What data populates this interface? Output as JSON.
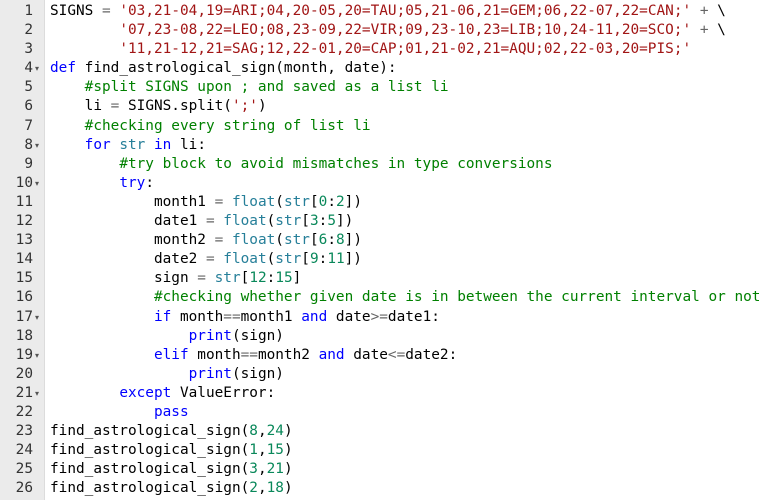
{
  "editor": {
    "lines": [
      {
        "n": "1",
        "fold": "",
        "segs": [
          {
            "t": "SIGNS",
            "k": "plain"
          },
          {
            "t": " ",
            "k": "plain"
          },
          {
            "t": "=",
            "k": "op"
          },
          {
            "t": " ",
            "k": "plain"
          },
          {
            "t": "'03,21-04,19=ARI;04,20-05,20=TAU;05,21-06,21=GEM;06,22-07,22=CAN;'",
            "k": "str"
          },
          {
            "t": " ",
            "k": "plain"
          },
          {
            "t": "+",
            "k": "op"
          },
          {
            "t": " \\",
            "k": "plain"
          }
        ]
      },
      {
        "n": "2",
        "fold": "",
        "segs": [
          {
            "t": "        ",
            "k": "plain"
          },
          {
            "t": "'07,23-08,22=LEO;08,23-09,22=VIR;09,23-10,23=LIB;10,24-11,20=SCO;'",
            "k": "str"
          },
          {
            "t": " ",
            "k": "plain"
          },
          {
            "t": "+",
            "k": "op"
          },
          {
            "t": " \\",
            "k": "plain"
          }
        ]
      },
      {
        "n": "3",
        "fold": "",
        "segs": [
          {
            "t": "        ",
            "k": "plain"
          },
          {
            "t": "'11,21-12,21=SAG;12,22-01,20=CAP;01,21-02,21=AQU;02,22-03,20=PIS;'",
            "k": "str"
          }
        ]
      },
      {
        "n": "4",
        "fold": "▾",
        "segs": [
          {
            "t": "def",
            "k": "kw"
          },
          {
            "t": " find_astrological_sign(month, date):",
            "k": "plain"
          }
        ]
      },
      {
        "n": "5",
        "fold": "",
        "segs": [
          {
            "t": "    ",
            "k": "plain"
          },
          {
            "t": "#split SIGNS upon ; and saved as a list li",
            "k": "cm"
          }
        ]
      },
      {
        "n": "6",
        "fold": "",
        "segs": [
          {
            "t": "    li ",
            "k": "plain"
          },
          {
            "t": "=",
            "k": "op"
          },
          {
            "t": " SIGNS.split(",
            "k": "plain"
          },
          {
            "t": "';'",
            "k": "str"
          },
          {
            "t": ")",
            "k": "plain"
          }
        ]
      },
      {
        "n": "7",
        "fold": "",
        "segs": [
          {
            "t": "    ",
            "k": "plain"
          },
          {
            "t": "#checking every string of list li",
            "k": "cm"
          }
        ]
      },
      {
        "n": "8",
        "fold": "▾",
        "segs": [
          {
            "t": "    ",
            "k": "plain"
          },
          {
            "t": "for",
            "k": "kw"
          },
          {
            "t": " ",
            "k": "plain"
          },
          {
            "t": "str",
            "k": "bi"
          },
          {
            "t": " ",
            "k": "plain"
          },
          {
            "t": "in",
            "k": "kw"
          },
          {
            "t": " li:",
            "k": "plain"
          }
        ]
      },
      {
        "n": "9",
        "fold": "",
        "segs": [
          {
            "t": "        ",
            "k": "plain"
          },
          {
            "t": "#try block to avoid mismatches in type conversions",
            "k": "cm"
          }
        ]
      },
      {
        "n": "10",
        "fold": "▾",
        "segs": [
          {
            "t": "        ",
            "k": "plain"
          },
          {
            "t": "try",
            "k": "kw"
          },
          {
            "t": ":",
            "k": "plain"
          }
        ]
      },
      {
        "n": "11",
        "fold": "",
        "segs": [
          {
            "t": "            month1 ",
            "k": "plain"
          },
          {
            "t": "=",
            "k": "op"
          },
          {
            "t": " ",
            "k": "plain"
          },
          {
            "t": "float",
            "k": "bi"
          },
          {
            "t": "(",
            "k": "plain"
          },
          {
            "t": "str",
            "k": "bi"
          },
          {
            "t": "[",
            "k": "plain"
          },
          {
            "t": "0",
            "k": "num"
          },
          {
            "t": ":",
            "k": "plain"
          },
          {
            "t": "2",
            "k": "num"
          },
          {
            "t": "])",
            "k": "plain"
          }
        ]
      },
      {
        "n": "12",
        "fold": "",
        "segs": [
          {
            "t": "            date1 ",
            "k": "plain"
          },
          {
            "t": "=",
            "k": "op"
          },
          {
            "t": " ",
            "k": "plain"
          },
          {
            "t": "float",
            "k": "bi"
          },
          {
            "t": "(",
            "k": "plain"
          },
          {
            "t": "str",
            "k": "bi"
          },
          {
            "t": "[",
            "k": "plain"
          },
          {
            "t": "3",
            "k": "num"
          },
          {
            "t": ":",
            "k": "plain"
          },
          {
            "t": "5",
            "k": "num"
          },
          {
            "t": "])",
            "k": "plain"
          }
        ]
      },
      {
        "n": "13",
        "fold": "",
        "segs": [
          {
            "t": "            month2 ",
            "k": "plain"
          },
          {
            "t": "=",
            "k": "op"
          },
          {
            "t": " ",
            "k": "plain"
          },
          {
            "t": "float",
            "k": "bi"
          },
          {
            "t": "(",
            "k": "plain"
          },
          {
            "t": "str",
            "k": "bi"
          },
          {
            "t": "[",
            "k": "plain"
          },
          {
            "t": "6",
            "k": "num"
          },
          {
            "t": ":",
            "k": "plain"
          },
          {
            "t": "8",
            "k": "num"
          },
          {
            "t": "])",
            "k": "plain"
          }
        ]
      },
      {
        "n": "14",
        "fold": "",
        "segs": [
          {
            "t": "            date2 ",
            "k": "plain"
          },
          {
            "t": "=",
            "k": "op"
          },
          {
            "t": " ",
            "k": "plain"
          },
          {
            "t": "float",
            "k": "bi"
          },
          {
            "t": "(",
            "k": "plain"
          },
          {
            "t": "str",
            "k": "bi"
          },
          {
            "t": "[",
            "k": "plain"
          },
          {
            "t": "9",
            "k": "num"
          },
          {
            "t": ":",
            "k": "plain"
          },
          {
            "t": "11",
            "k": "num"
          },
          {
            "t": "])",
            "k": "plain"
          }
        ]
      },
      {
        "n": "15",
        "fold": "",
        "segs": [
          {
            "t": "            sign ",
            "k": "plain"
          },
          {
            "t": "=",
            "k": "op"
          },
          {
            "t": " ",
            "k": "plain"
          },
          {
            "t": "str",
            "k": "bi"
          },
          {
            "t": "[",
            "k": "plain"
          },
          {
            "t": "12",
            "k": "num"
          },
          {
            "t": ":",
            "k": "plain"
          },
          {
            "t": "15",
            "k": "num"
          },
          {
            "t": "]",
            "k": "plain"
          }
        ]
      },
      {
        "n": "16",
        "fold": "",
        "segs": [
          {
            "t": "            ",
            "k": "plain"
          },
          {
            "t": "#checking whether given date is in between the current interval or not",
            "k": "cm"
          }
        ]
      },
      {
        "n": "17",
        "fold": "▾",
        "segs": [
          {
            "t": "            ",
            "k": "plain"
          },
          {
            "t": "if",
            "k": "kw"
          },
          {
            "t": " month",
            "k": "plain"
          },
          {
            "t": "==",
            "k": "op"
          },
          {
            "t": "month1 ",
            "k": "plain"
          },
          {
            "t": "and",
            "k": "kw"
          },
          {
            "t": " date",
            "k": "plain"
          },
          {
            "t": ">=",
            "k": "op"
          },
          {
            "t": "date1:",
            "k": "plain"
          }
        ]
      },
      {
        "n": "18",
        "fold": "",
        "segs": [
          {
            "t": "                ",
            "k": "plain"
          },
          {
            "t": "print",
            "k": "kw"
          },
          {
            "t": "(sign)",
            "k": "plain"
          }
        ]
      },
      {
        "n": "19",
        "fold": "▾",
        "segs": [
          {
            "t": "            ",
            "k": "plain"
          },
          {
            "t": "elif",
            "k": "kw"
          },
          {
            "t": " month",
            "k": "plain"
          },
          {
            "t": "==",
            "k": "op"
          },
          {
            "t": "month2 ",
            "k": "plain"
          },
          {
            "t": "and",
            "k": "kw"
          },
          {
            "t": " date",
            "k": "plain"
          },
          {
            "t": "<=",
            "k": "op"
          },
          {
            "t": "date2:",
            "k": "plain"
          }
        ]
      },
      {
        "n": "20",
        "fold": "",
        "segs": [
          {
            "t": "                ",
            "k": "plain"
          },
          {
            "t": "print",
            "k": "kw"
          },
          {
            "t": "(sign)",
            "k": "plain"
          }
        ]
      },
      {
        "n": "21",
        "fold": "▾",
        "segs": [
          {
            "t": "        ",
            "k": "plain"
          },
          {
            "t": "except",
            "k": "kw"
          },
          {
            "t": " ValueError:",
            "k": "plain"
          }
        ]
      },
      {
        "n": "22",
        "fold": "",
        "segs": [
          {
            "t": "            ",
            "k": "plain"
          },
          {
            "t": "pass",
            "k": "kw"
          }
        ]
      },
      {
        "n": "23",
        "fold": "",
        "segs": [
          {
            "t": "find_astrological_sign(",
            "k": "plain"
          },
          {
            "t": "8",
            "k": "num"
          },
          {
            "t": ",",
            "k": "plain"
          },
          {
            "t": "24",
            "k": "num"
          },
          {
            "t": ")",
            "k": "plain"
          }
        ]
      },
      {
        "n": "24",
        "fold": "",
        "segs": [
          {
            "t": "find_astrological_sign(",
            "k": "plain"
          },
          {
            "t": "1",
            "k": "num"
          },
          {
            "t": ",",
            "k": "plain"
          },
          {
            "t": "15",
            "k": "num"
          },
          {
            "t": ")",
            "k": "plain"
          }
        ]
      },
      {
        "n": "25",
        "fold": "",
        "segs": [
          {
            "t": "find_astrological_sign(",
            "k": "plain"
          },
          {
            "t": "3",
            "k": "num"
          },
          {
            "t": ",",
            "k": "plain"
          },
          {
            "t": "21",
            "k": "num"
          },
          {
            "t": ")",
            "k": "plain"
          }
        ]
      },
      {
        "n": "26",
        "fold": "",
        "segs": [
          {
            "t": "find_astrological_sign(",
            "k": "plain"
          },
          {
            "t": "2",
            "k": "num"
          },
          {
            "t": ",",
            "k": "plain"
          },
          {
            "t": "18",
            "k": "num"
          },
          {
            "t": ")",
            "k": "plain"
          }
        ]
      }
    ]
  }
}
